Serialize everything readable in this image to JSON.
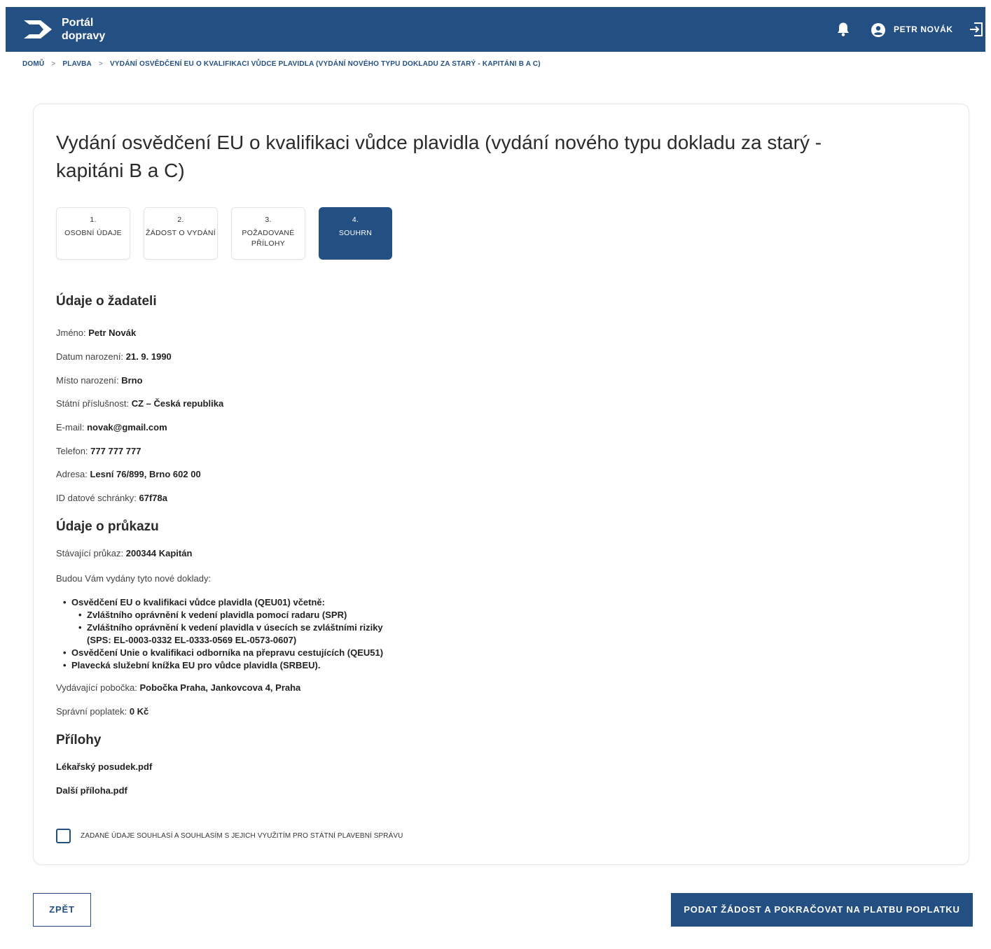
{
  "header": {
    "brand_line1": "Portál",
    "brand_line2": "dopravy",
    "user_name": "PETR NOVÁK",
    "icons": [
      "logo-arrow-icon",
      "bell-icon",
      "account-icon",
      "logout-icon"
    ]
  },
  "breadcrumb": {
    "items": [
      "DOMŮ",
      "PLAVBA",
      "VYDÁNÍ OSVĚDČENÍ EU O KVALIFIKACI VŮDCE PLAVIDLA (VYDÁNÍ NOVÉHO TYPU DOKLADU ZA STARÝ - KAPITÁNI B A C)"
    ],
    "separator": ">"
  },
  "page": {
    "title": "Vydání osvědčení EU o kvalifikaci vůdce plavidla (vydání nového typu dokladu za starý - kapitáni B a C)"
  },
  "steps": [
    {
      "num": "1.",
      "label": "OSOBNÍ ÚDAJE"
    },
    {
      "num": "2.",
      "label": "ŽÁDOST O VYDÁNÍ"
    },
    {
      "num": "3.",
      "label": "POŽADOVANÉ PŘÍLOHY"
    },
    {
      "num": "4.",
      "label": "SOUHRN",
      "active": true
    }
  ],
  "applicant": {
    "heading": "Údaje o žadateli",
    "fields": [
      {
        "label": "Jméno:",
        "value": "Petr Novák"
      },
      {
        "label": "Datum narození:",
        "value": "21. 9. 1990"
      },
      {
        "label": "Místo narození:",
        "value": "Brno"
      },
      {
        "label": "Státní příslušnost:",
        "value": "CZ – Česká republika"
      },
      {
        "label": "E-mail:",
        "value": "novak@gmail.com"
      },
      {
        "label": "Telefon:",
        "value": "777 777 777"
      },
      {
        "label": "Adresa:",
        "value": "Lesní 76/899, Brno 602 00"
      },
      {
        "label": "ID datové schránky:",
        "value": "67f78a"
      }
    ]
  },
  "license": {
    "heading": "Údaje o průkazu",
    "current_label": "Stávající průkaz:",
    "current_value": "200344 Kapitán",
    "intro": "Budou Vám vydány tyto nové doklady:",
    "docs": {
      "d1": "Osvědčení EU o kvalifikaci vůdce plavidla (QEU01) včetně:",
      "d1_sub1": "Zvláštního oprávnění k vedení plavidla pomocí radaru (SPR)",
      "d1_sub2": "Zvláštního oprávnění k vedení plavidla v úsecích se zvláštními riziky",
      "d1_sub2_cont": "(SPS: EL-0003-0332 EL-0333-0569 EL-0573-0607)",
      "d2": "Osvědčení Unie o kvalifikaci odborníka na přepravu cestujících (QEU51)",
      "d3": "Plavecká služební knížka EU pro vůdce plavidla (SRBEU)."
    },
    "branch_label": "Vydávající pobočka:",
    "branch_value": "Pobočka Praha, Jankovcova 4, Praha",
    "fee_label": "Správní poplatek:",
    "fee_value": "0 Kč"
  },
  "attachments": {
    "heading": "Přílohy",
    "files": [
      "Lékařský posudek.pdf",
      "Další příloha.pdf"
    ]
  },
  "consent": {
    "label": "ZADANÉ ÚDAJE SOUHLASÍ A SOUHLASÍM S JEJICH VYUŽITÍM PRO STÁTNÍ PLAVEBNÍ SPRÁVU",
    "checked": false
  },
  "actions": {
    "back": "ZPĚT",
    "submit": "PODAT ŽÁDOST A POKRAČOVAT NA PLATBU POPLATKU"
  },
  "colors": {
    "primary": "#234f82",
    "border": "#e1e4e8"
  }
}
